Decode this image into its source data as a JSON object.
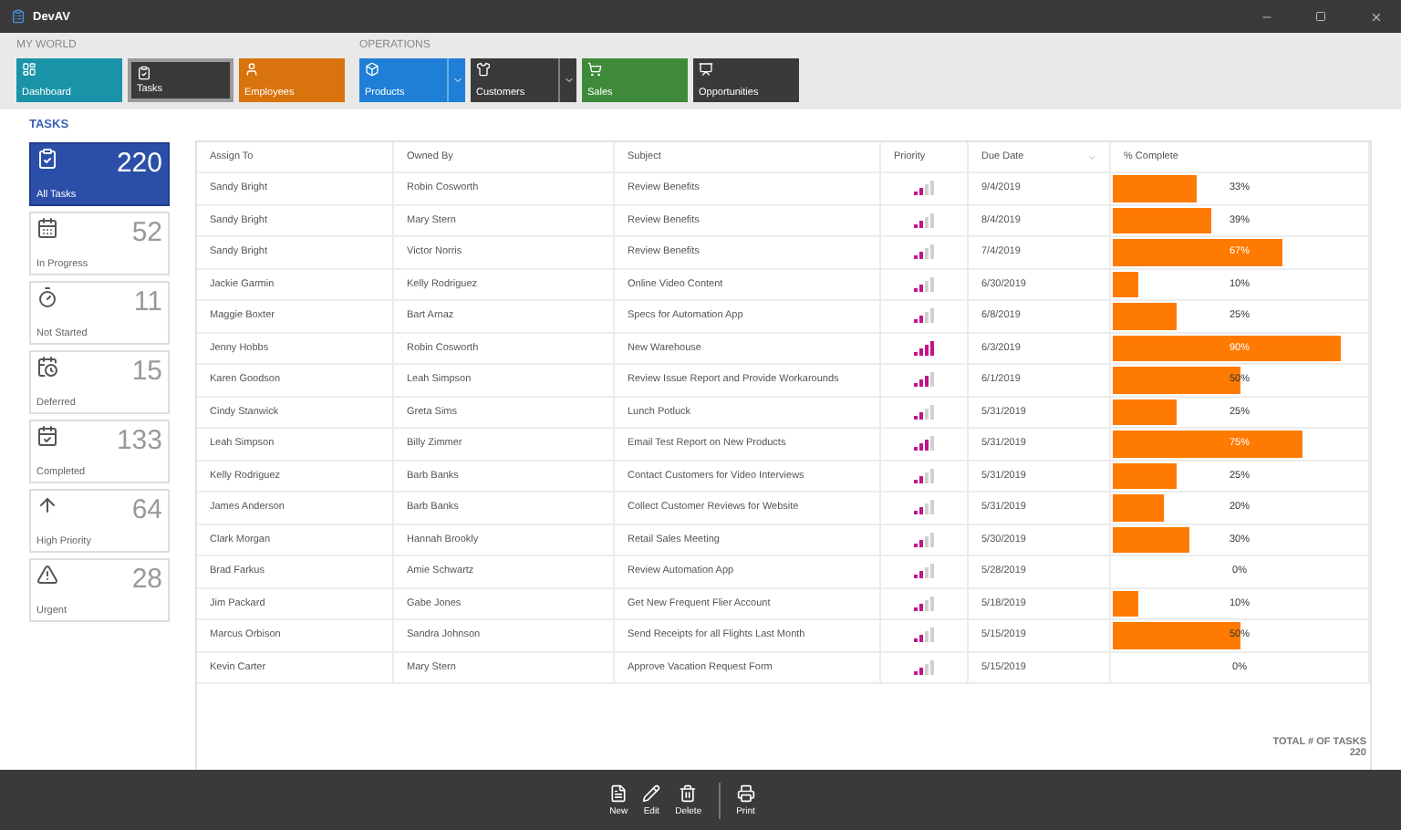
{
  "window": {
    "title": "DevAV"
  },
  "ribbon": {
    "groups": [
      {
        "label": "MY WORLD",
        "tiles": [
          {
            "label": "Dashboard",
            "kind": "dashboard",
            "color": "#1a93a8",
            "selected": false,
            "dropdown": false
          },
          {
            "label": "Tasks",
            "kind": "tasks",
            "color": "#3a3a3a",
            "selected": true,
            "dropdown": false
          },
          {
            "label": "Employees",
            "kind": "employees",
            "color": "#d9730d",
            "selected": false,
            "dropdown": false
          }
        ]
      },
      {
        "label": "OPERATIONS",
        "tiles": [
          {
            "label": "Products",
            "kind": "products",
            "color": "#1f7fd6",
            "selected": false,
            "dropdown": true
          },
          {
            "label": "Customers",
            "kind": "customers",
            "color": "#3a3a3a",
            "selected": false,
            "dropdown": true
          },
          {
            "label": "Sales",
            "kind": "sales",
            "color": "#3f8a3a",
            "selected": false,
            "dropdown": false
          },
          {
            "label": "Opportunities",
            "kind": "opportunities",
            "color": "#3a3a3a",
            "selected": false,
            "dropdown": false
          }
        ]
      }
    ]
  },
  "section_title": "TASKS",
  "filters": [
    {
      "label": "All Tasks",
      "count": "220",
      "kind": "all",
      "selected": true
    },
    {
      "label": "In Progress",
      "count": "52",
      "kind": "progress",
      "selected": false
    },
    {
      "label": "Not Started",
      "count": "11",
      "kind": "notstarted",
      "selected": false
    },
    {
      "label": "Deferred",
      "count": "15",
      "kind": "deferred",
      "selected": false
    },
    {
      "label": "Completed",
      "count": "133",
      "kind": "completed",
      "selected": false
    },
    {
      "label": "High Priority",
      "count": "64",
      "kind": "high",
      "selected": false
    },
    {
      "label": "Urgent",
      "count": "28",
      "kind": "urgent",
      "selected": false
    }
  ],
  "table": {
    "columns": [
      "Assign To",
      "Owned By",
      "Subject",
      "Priority",
      "Due Date",
      "% Complete"
    ],
    "rows": [
      {
        "assign_to": "Sandy Bright",
        "owned_by": "Robin Cosworth",
        "subject": "Review Benefits",
        "priority": {
          "kind": "normal"
        },
        "due_date": "9/4/2019",
        "level": 0.33,
        "complete": "33%"
      },
      {
        "assign_to": "Sandy Bright",
        "owned_by": "Mary Stern",
        "subject": "Review Benefits",
        "priority": {
          "kind": "normal"
        },
        "due_date": "8/4/2019",
        "level": 0.39,
        "complete": "39%"
      },
      {
        "assign_to": "Sandy Bright",
        "owned_by": "Victor Norris",
        "subject": "Review Benefits",
        "priority": {
          "kind": "normal"
        },
        "due_date": "7/4/2019",
        "level": 0.67,
        "complete": "67%"
      },
      {
        "assign_to": "Jackie Garmin",
        "owned_by": "Kelly Rodriguez",
        "subject": "Online Video Content",
        "priority": {
          "kind": "normal"
        },
        "due_date": "6/30/2019",
        "level": 0.1,
        "complete": "10%"
      },
      {
        "assign_to": "Maggie Boxter",
        "owned_by": "Bart Arnaz",
        "subject": "Specs for Automation App",
        "priority": {
          "kind": "normal"
        },
        "due_date": "6/8/2019",
        "level": 0.25,
        "complete": "25%"
      },
      {
        "assign_to": "Jenny Hobbs",
        "owned_by": "Robin Cosworth",
        "subject": "New Warehouse",
        "priority": {
          "kind": "urgent"
        },
        "due_date": "6/3/2019",
        "level": 0.9,
        "complete": "90%"
      },
      {
        "assign_to": "Karen Goodson",
        "owned_by": "Leah Simpson",
        "subject": "Review Issue Report and Provide Workarounds",
        "priority": {
          "kind": "high"
        },
        "due_date": "6/1/2019",
        "level": 0.5,
        "complete": "50%"
      },
      {
        "assign_to": "Cindy Stanwick",
        "owned_by": "Greta Sims",
        "subject": "Lunch Potluck",
        "priority": {
          "kind": "normal"
        },
        "due_date": "5/31/2019",
        "level": 0.25,
        "complete": "25%"
      },
      {
        "assign_to": "Leah Simpson",
        "owned_by": "Billy Zimmer",
        "subject": "Email Test Report on New Products",
        "priority": {
          "kind": "high"
        },
        "due_date": "5/31/2019",
        "level": 0.75,
        "complete": "75%"
      },
      {
        "assign_to": "Kelly Rodriguez",
        "owned_by": "Barb Banks",
        "subject": "Contact Customers for Video Interviews",
        "priority": {
          "kind": "normal"
        },
        "due_date": "5/31/2019",
        "level": 0.25,
        "complete": "25%"
      },
      {
        "assign_to": "James Anderson",
        "owned_by": "Barb Banks",
        "subject": "Collect Customer Reviews for Website",
        "priority": {
          "kind": "normal"
        },
        "due_date": "5/31/2019",
        "level": 0.2,
        "complete": "20%"
      },
      {
        "assign_to": "Clark Morgan",
        "owned_by": "Hannah Brookly",
        "subject": "Retail Sales Meeting",
        "priority": {
          "kind": "normal"
        },
        "due_date": "5/30/2019",
        "level": 0.3,
        "complete": "30%"
      },
      {
        "assign_to": "Brad Farkus",
        "owned_by": "Amie Schwartz",
        "subject": "Review Automation App",
        "priority": {
          "kind": "normal"
        },
        "due_date": "5/28/2019",
        "complete": "0%"
      },
      {
        "assign_to": "Jim Packard",
        "owned_by": "Gabe Jones",
        "subject": "Get New Frequent Flier Account",
        "priority": {
          "kind": "normal"
        },
        "due_date": "5/18/2019",
        "level": 0.1,
        "complete": "10%"
      },
      {
        "assign_to": "Marcus Orbison",
        "owned_by": "Sandra Johnson",
        "subject": "Send Receipts for all Flights Last Month",
        "priority": {
          "kind": "normal"
        },
        "due_date": "5/15/2019",
        "level": 0.5,
        "complete": "50%"
      },
      {
        "assign_to": "Kevin Carter",
        "owned_by": "Mary Stern",
        "subject": "Approve Vacation Request Form",
        "priority": {
          "kind": "normal"
        },
        "due_date": "5/15/2019",
        "complete": "0%"
      }
    ]
  },
  "total": {
    "label": "TOTAL # OF TASKS",
    "value": "220"
  },
  "toolbar": [
    {
      "label": "New",
      "kind": "new"
    },
    {
      "label": "Edit",
      "kind": "edit"
    },
    {
      "label": "Delete",
      "kind": "delete"
    },
    {
      "label": "Print",
      "kind": "print"
    }
  ]
}
